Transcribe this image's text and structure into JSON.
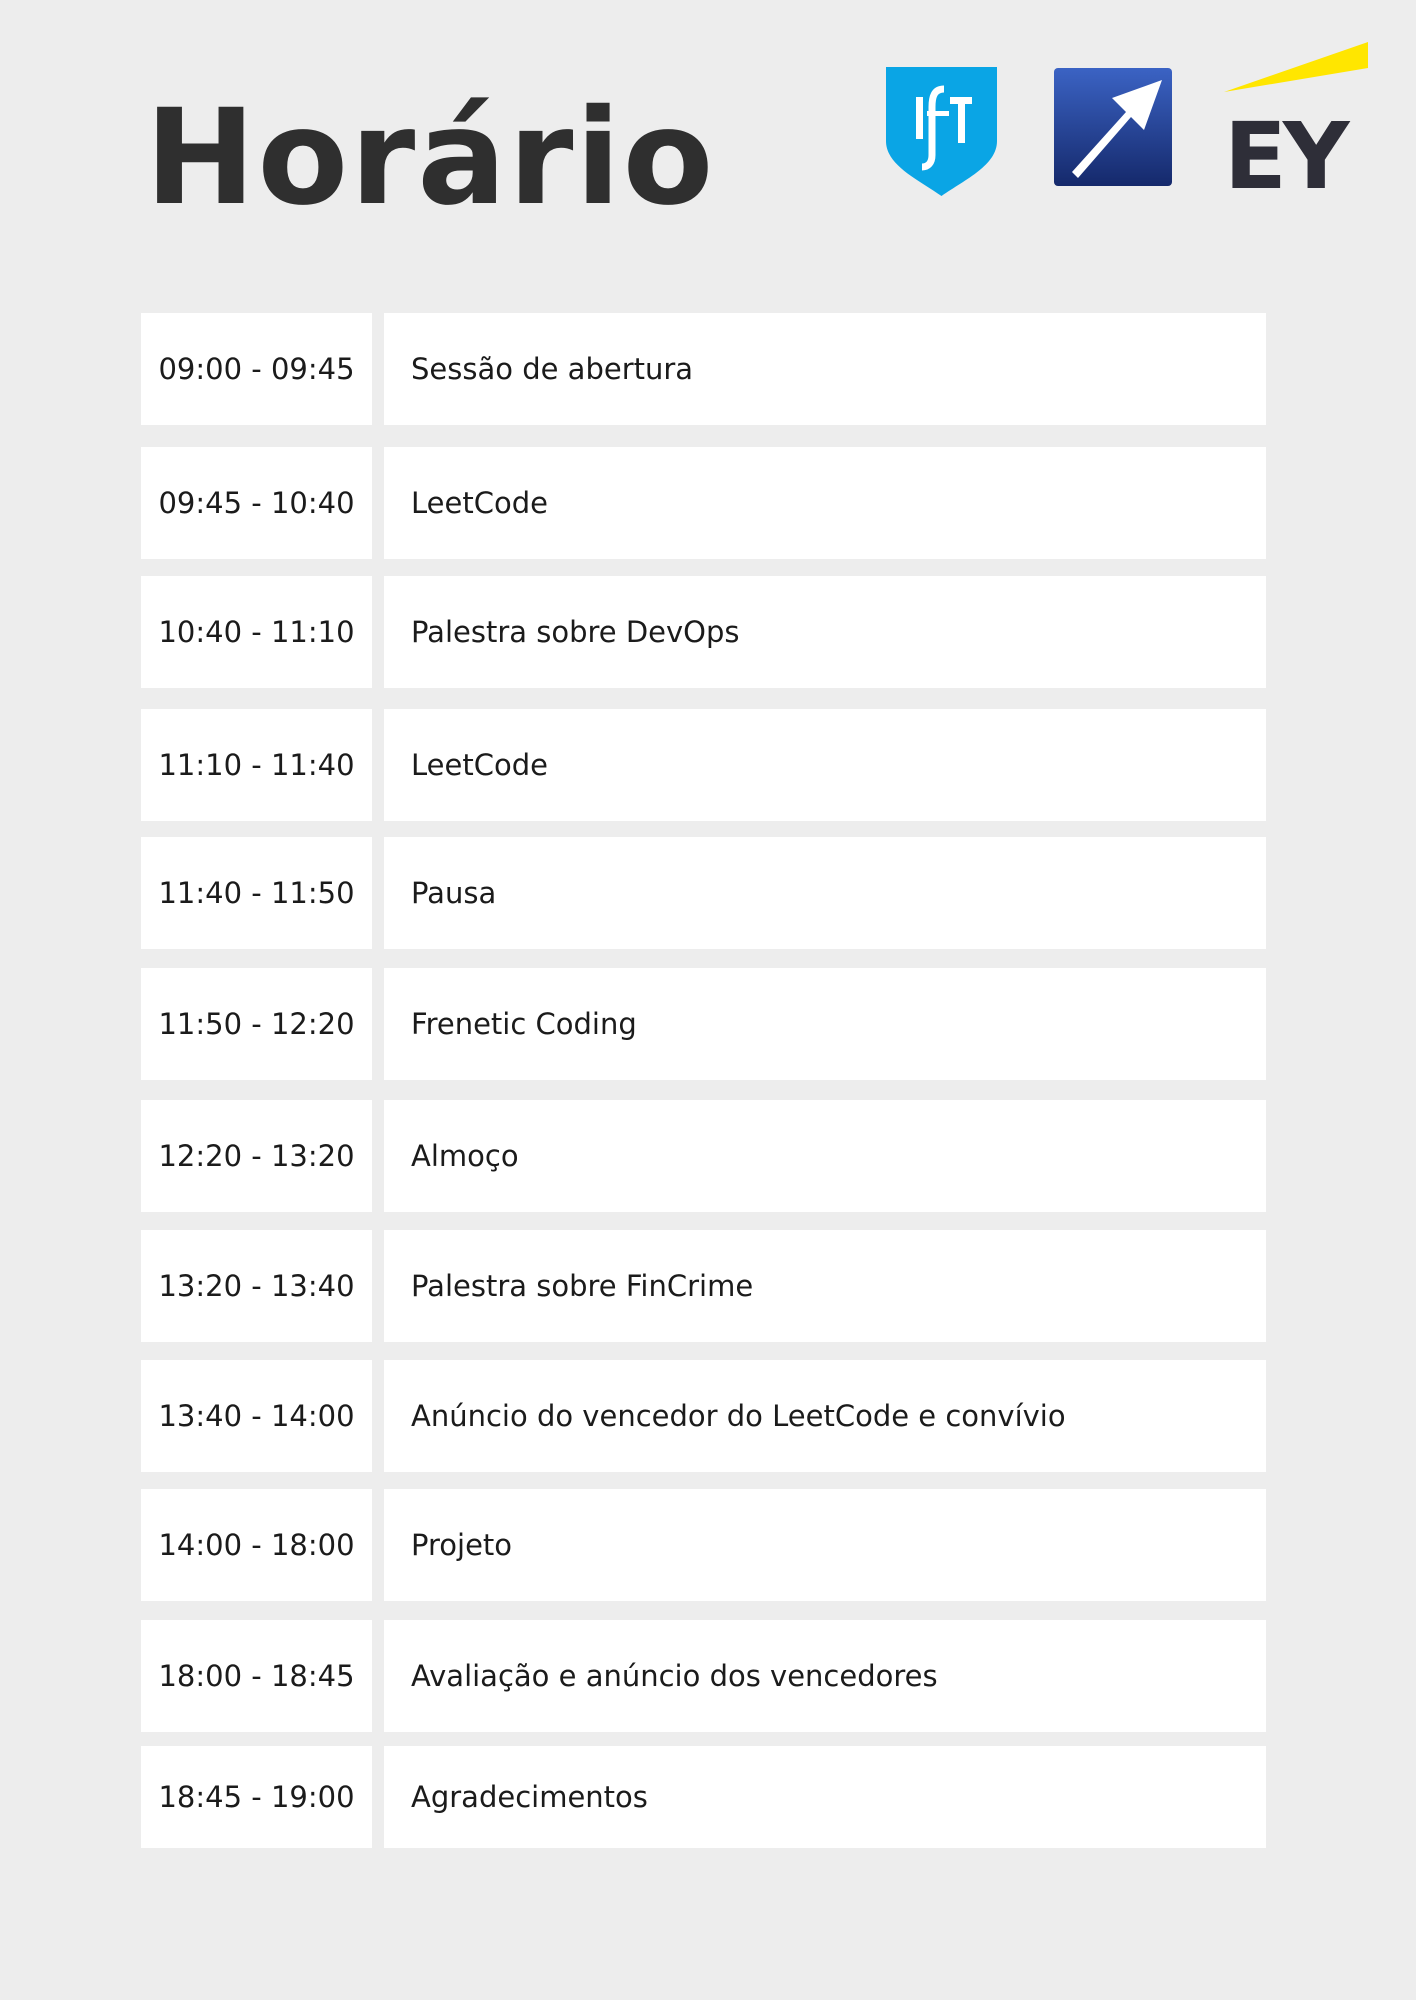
{
  "page": {
    "title": "Horário"
  },
  "logos": [
    {
      "icon": "ist-shield-logo",
      "text": "IST",
      "color": "#0aa5e5"
    },
    {
      "icon": "arrow-logo",
      "color": "#1f3f9a"
    },
    {
      "icon": "ey-logo",
      "text": "EY",
      "color": "#2e2e38",
      "accent": "#ffe600"
    }
  ],
  "schedule": [
    {
      "time": "09:00 - 09:45",
      "event": "Sessão de abertura"
    },
    {
      "time": "09:45 - 10:40",
      "event": "LeetCode"
    },
    {
      "time": "10:40 - 11:10",
      "event": "Palestra sobre DevOps"
    },
    {
      "time": "11:10 - 11:40",
      "event": "LeetCode"
    },
    {
      "time": "11:40 - 11:50",
      "event": "Pausa"
    },
    {
      "time": "11:50 - 12:20",
      "event": "Frenetic Coding"
    },
    {
      "time": "12:20 - 13:20",
      "event": "Almoço"
    },
    {
      "time": "13:20 - 13:40",
      "event": "Palestra sobre FinCrime"
    },
    {
      "time": "13:40 - 14:00",
      "event": "Anúncio do vencedor do LeetCode e convívio"
    },
    {
      "time": "14:00 - 18:00",
      "event": "Projeto"
    },
    {
      "time": "18:00 - 18:45",
      "event": "Avaliação e anúncio dos vencedores"
    },
    {
      "time": "18:45 - 19:00",
      "event": "Agradecimentos"
    }
  ],
  "colors": {
    "background": "#ededed",
    "cell": "#ffffff",
    "title": "#2f2f2f",
    "text": "#1b1b1b"
  }
}
